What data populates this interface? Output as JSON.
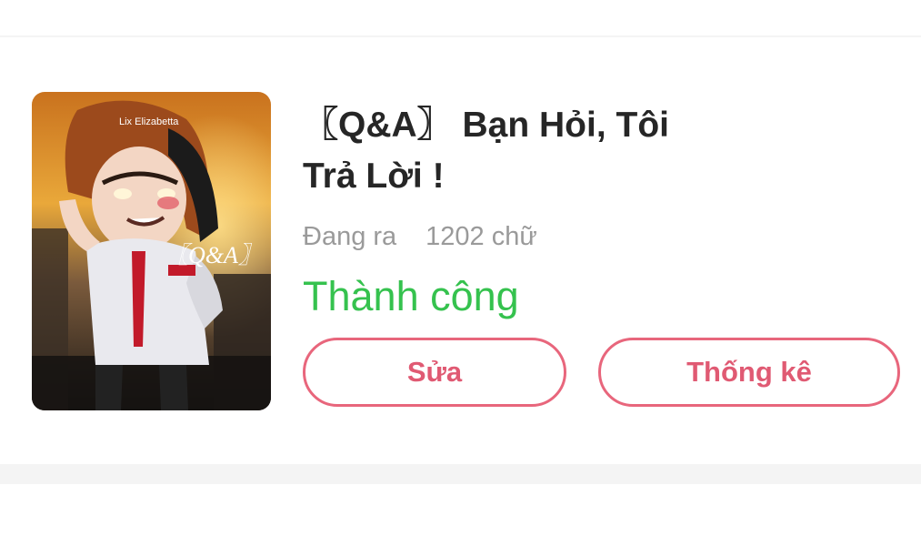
{
  "story": {
    "cover": {
      "watermark": "Lix Elizabetta",
      "badge": "〖Q&A〗"
    },
    "title_line1": "〖Q&A〗 Bạn Hỏi, Tôi",
    "title_line2": "Trả Lời !",
    "status": "Đang ra",
    "word_count": "1202 chữ",
    "result": "Thành công"
  },
  "actions": {
    "edit_label": "Sửa",
    "stats_label": "Thống kê"
  },
  "colors": {
    "success": "#35c24e",
    "accent": "#e8667c",
    "title": "#262626",
    "muted": "#9a9a9a"
  }
}
